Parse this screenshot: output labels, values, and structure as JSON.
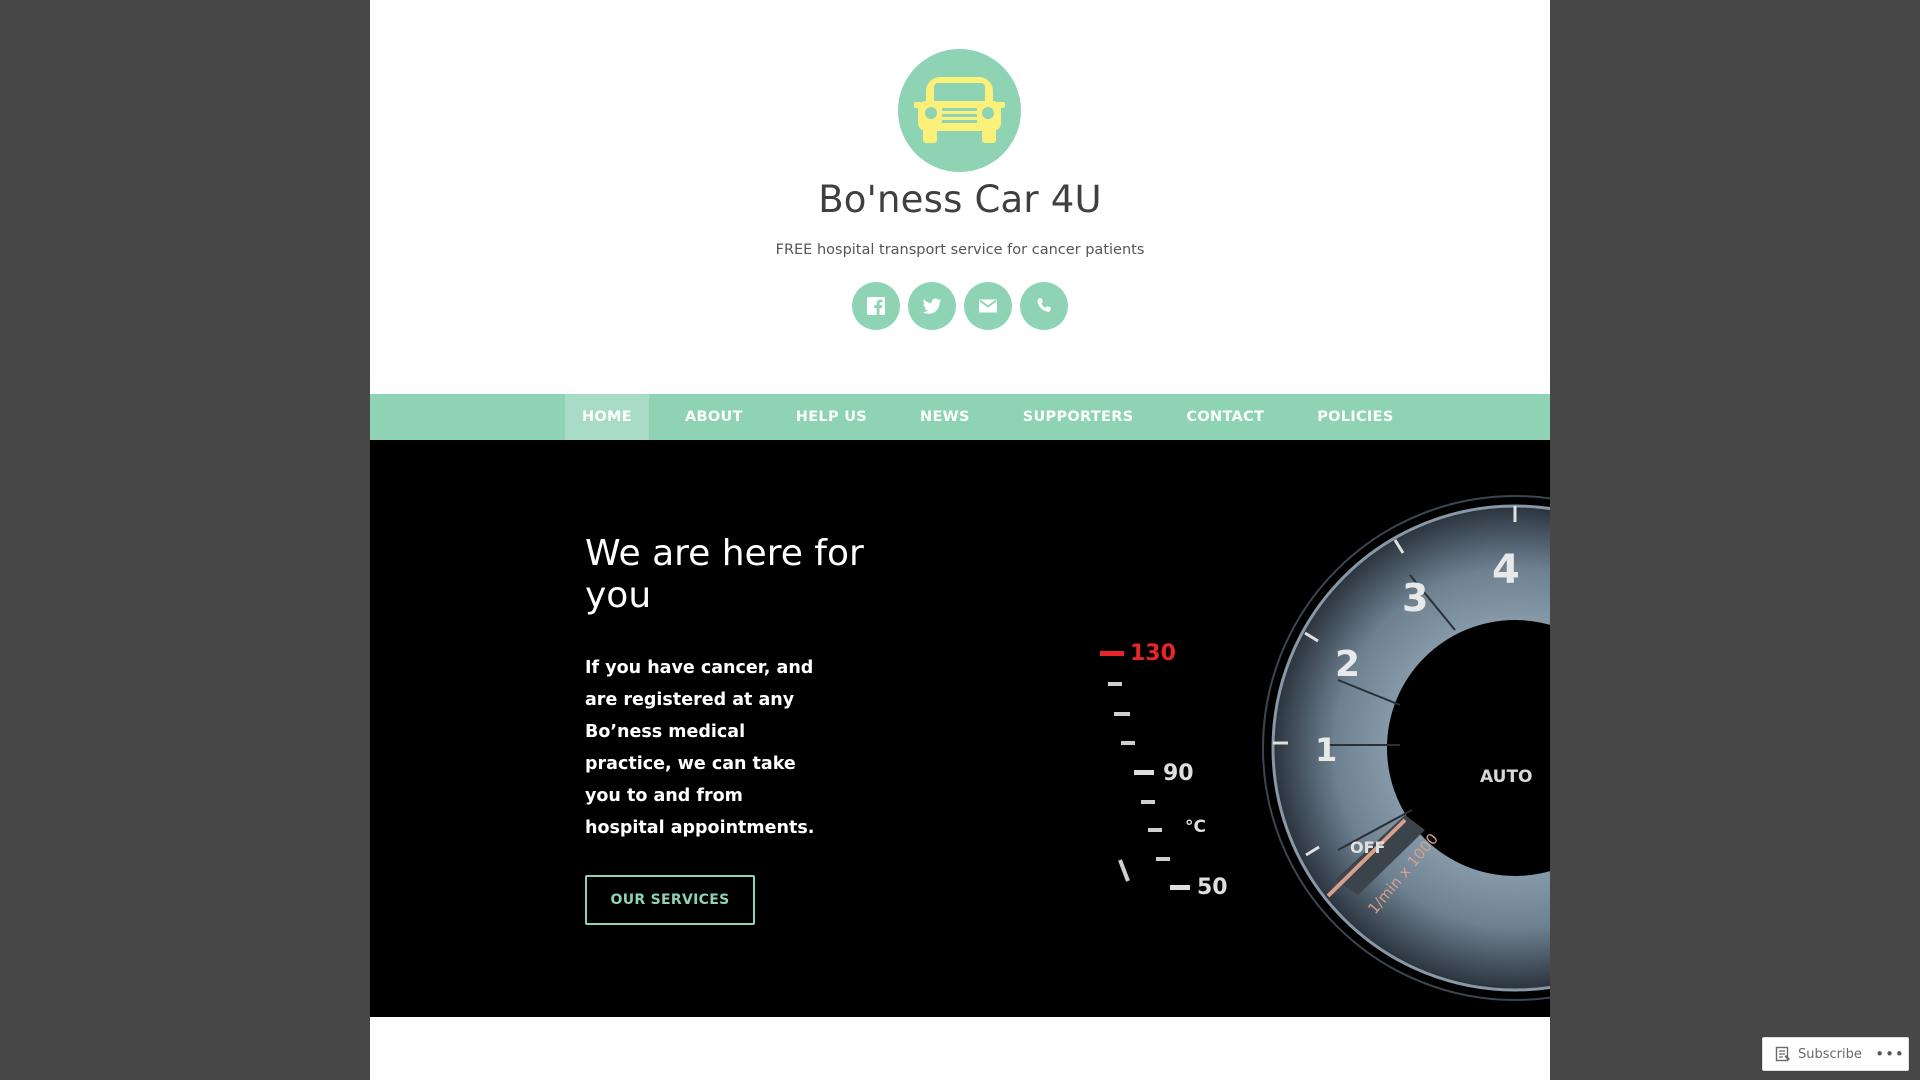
{
  "site": {
    "title": "Bo'ness Car 4U",
    "tagline": "FREE hospital transport service for cancer patients"
  },
  "social": [
    {
      "name": "facebook-icon"
    },
    {
      "name": "twitter-icon"
    },
    {
      "name": "email-icon"
    },
    {
      "name": "phone-icon"
    }
  ],
  "nav": {
    "items": [
      {
        "label": "HOME",
        "active": true
      },
      {
        "label": "ABOUT"
      },
      {
        "label": "HELP US"
      },
      {
        "label": "NEWS"
      },
      {
        "label": "SUPPORTERS"
      },
      {
        "label": "CONTACT"
      },
      {
        "label": "POLICIES"
      }
    ]
  },
  "hero": {
    "title": "We are here for you",
    "text": "If you have cancer, and are registered at any Bo’ness medical practice, we can take you to and from hospital appointments.",
    "button": "OUR SERVICES",
    "gauge": {
      "temp_labels": [
        "130",
        "90",
        "50"
      ],
      "temp_unit": "°C",
      "rpm_labels": [
        "1",
        "2",
        "3",
        "4"
      ],
      "off_label": "OFF",
      "rpm_unit": "1/min x 1000",
      "mode_label": "AUTO"
    }
  },
  "footer_bar": {
    "subscribe": "Subscribe",
    "more": "•••"
  },
  "colors": {
    "accent": "#8dd3b4",
    "background": "#474747",
    "logo_car": "#fbf07a",
    "hero_bg": "#000000"
  }
}
